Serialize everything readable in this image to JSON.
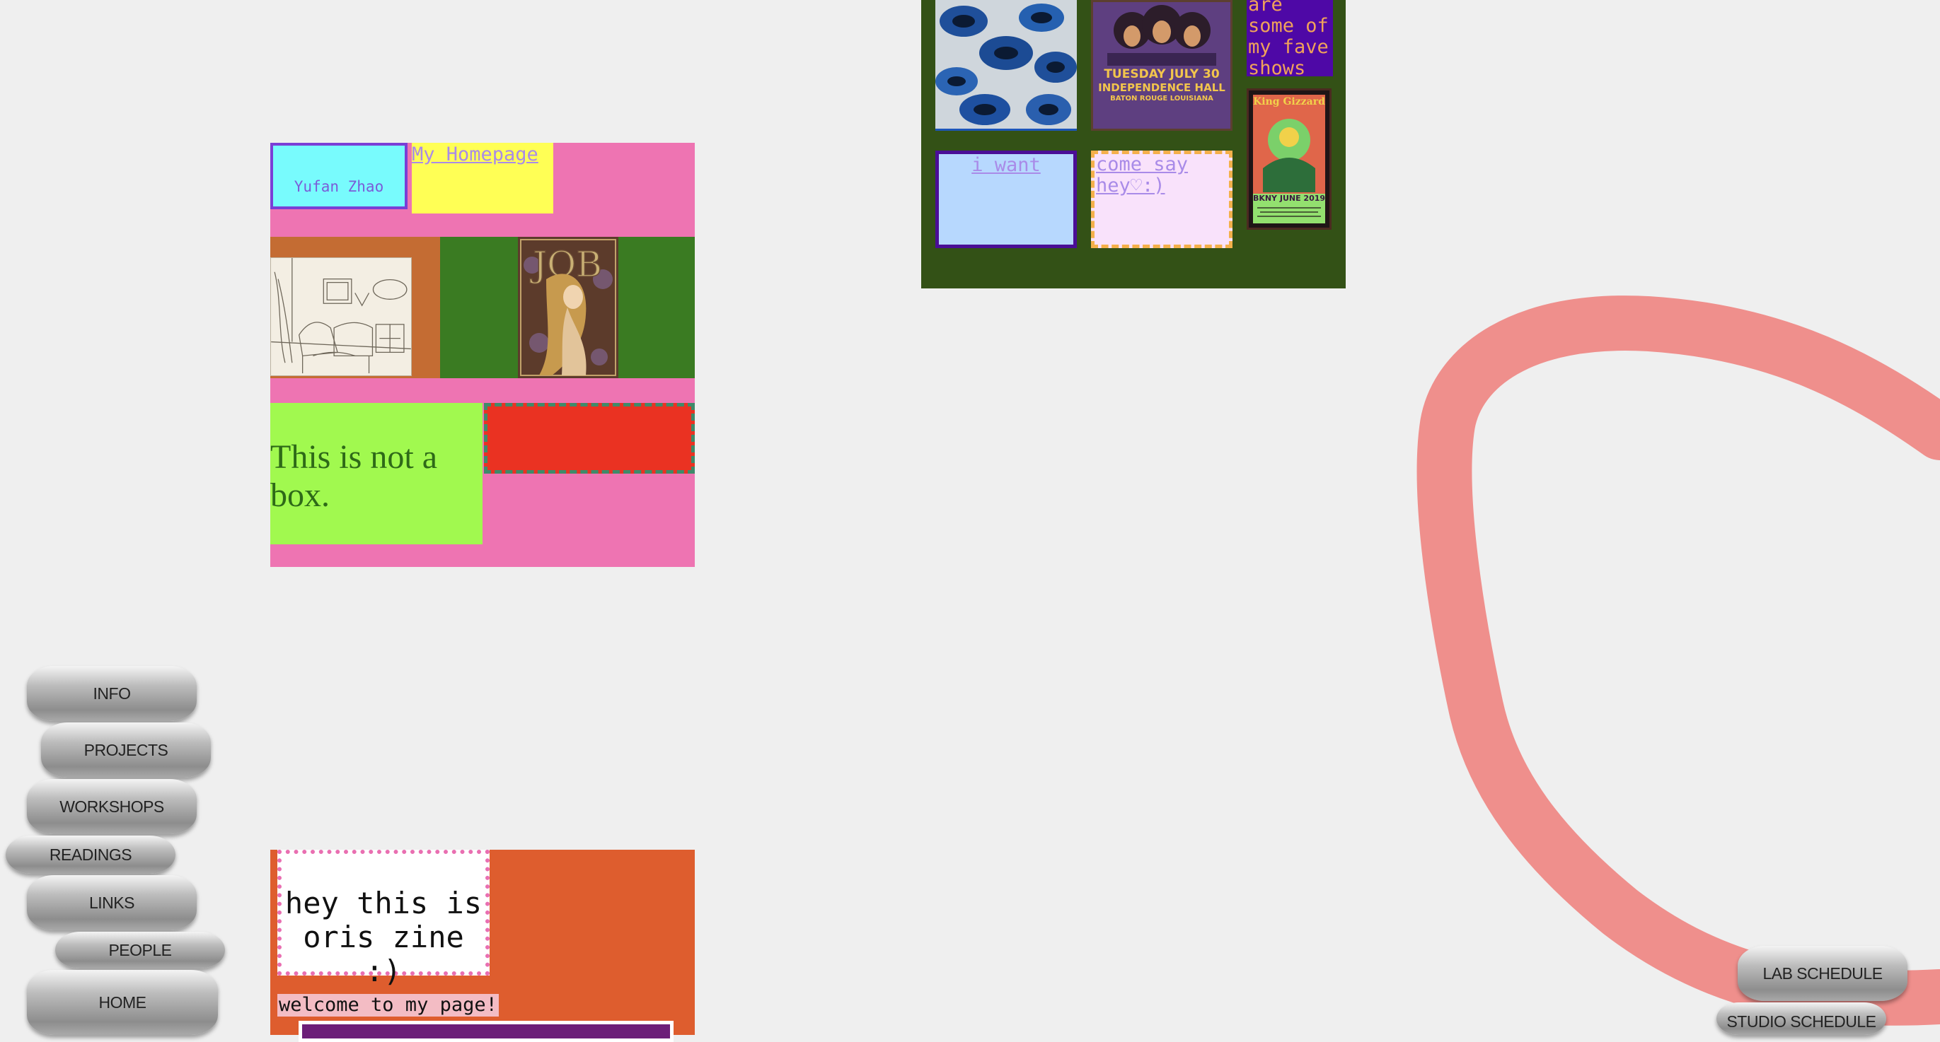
{
  "page_a": {
    "name": "Yufan Zhao",
    "homepage_link": "My Homepage",
    "statement": "This is not a box."
  },
  "page_b": {
    "fave_shows": "are some of my fave shows",
    "want_link": "i want",
    "hey_link": "come say hey♡:)",
    "hendrix_poster": {
      "date": "TUESDAY JULY 30",
      "venue": "INDEPENDENCE HALL",
      "city": "BATON ROUGE LOUISIANA"
    },
    "gizzard_poster": {
      "band": "King Gizzard",
      "footer": "BKNY JUNE 2019"
    }
  },
  "page_c": {
    "zine": "hey this is oris zine :)",
    "welcome": "welcome to my page!"
  },
  "nav": {
    "info": "INFO",
    "projects": "PROJECTS",
    "workshops": "WORKSHOPS",
    "readings": "READINGS",
    "links": "LINKS",
    "people": "PEOPLE",
    "home": "HOME",
    "lab_schedule": "LAB SCHEDULE",
    "studio_schedule": "STUDIO SCHEDULE"
  },
  "colors": {
    "background": "#efefef",
    "loop_stroke": "#ef8f8c"
  }
}
